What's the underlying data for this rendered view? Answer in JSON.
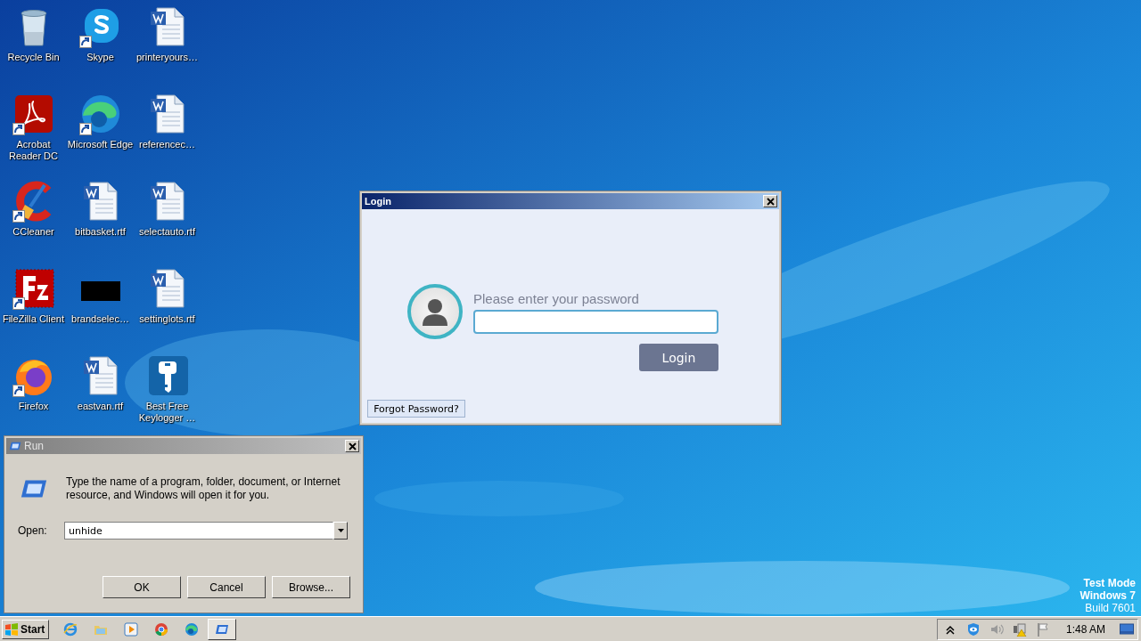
{
  "desktop": {
    "icons": [
      {
        "label": "Recycle Bin",
        "kind": "recycle",
        "shortcut": false
      },
      {
        "label": "Skype",
        "kind": "skype",
        "shortcut": true
      },
      {
        "label": "printeryours…",
        "kind": "word",
        "shortcut": false
      },
      {
        "label": "Acrobat Reader DC",
        "kind": "acrobat",
        "shortcut": true
      },
      {
        "label": "Microsoft Edge",
        "kind": "edge",
        "shortcut": true
      },
      {
        "label": "referencec…",
        "kind": "word",
        "shortcut": false
      },
      {
        "label": "CCleaner",
        "kind": "ccleaner",
        "shortcut": true
      },
      {
        "label": "bitbasket.rtf",
        "kind": "word",
        "shortcut": false
      },
      {
        "label": "selectauto.rtf",
        "kind": "word",
        "shortcut": false
      },
      {
        "label": "FileZilla Client",
        "kind": "filezilla",
        "shortcut": true
      },
      {
        "label": "brandselec…",
        "kind": "blank",
        "shortcut": false
      },
      {
        "label": "settinglots.rtf",
        "kind": "word",
        "shortcut": false
      },
      {
        "label": "Firefox",
        "kind": "firefox",
        "shortcut": true
      },
      {
        "label": "eastvan.rtf",
        "kind": "word",
        "shortcut": false
      },
      {
        "label": "Best Free Keylogger …",
        "kind": "key",
        "shortcut": false
      }
    ],
    "mode_text": [
      "Test Mode",
      "Windows 7",
      "Build 7601"
    ]
  },
  "login_window": {
    "title": "Login",
    "active": true,
    "prompt": "Please enter your password",
    "login_button": "Login",
    "forgot_button": "Forgot Password?"
  },
  "run_window": {
    "title": "Run",
    "active": false,
    "message": "Type the name of a program, folder, document, or Internet resource, and Windows will open it for you.",
    "open_label": "Open:",
    "open_value": "unhide",
    "buttons": [
      "OK",
      "Cancel",
      "Browse..."
    ]
  },
  "taskbar": {
    "start": "Start",
    "items": [
      {
        "kind": "ie",
        "active": false
      },
      {
        "kind": "folder",
        "active": false
      },
      {
        "kind": "media",
        "active": false
      },
      {
        "kind": "chrome",
        "active": false
      },
      {
        "kind": "edge",
        "active": false
      },
      {
        "kind": "run",
        "active": true
      }
    ],
    "tray": [
      {
        "kind": "chevron"
      },
      {
        "kind": "shield"
      },
      {
        "kind": "speaker"
      },
      {
        "kind": "network"
      },
      {
        "kind": "flag"
      }
    ],
    "time": "1:48 AM"
  }
}
